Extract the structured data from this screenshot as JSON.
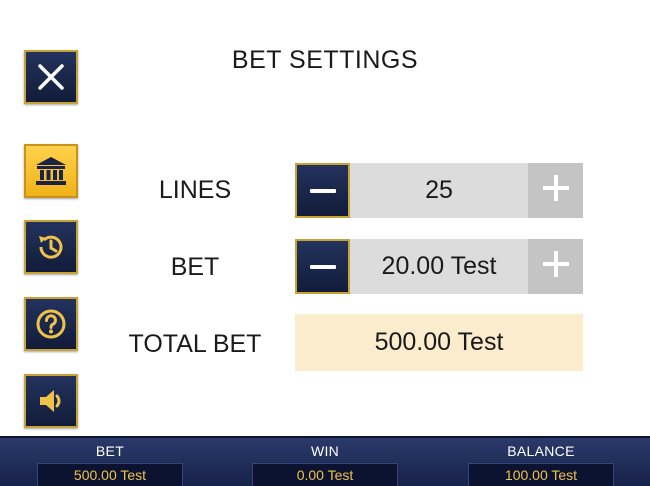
{
  "title": "BET SETTINGS",
  "sidebar": {
    "close": {
      "icon": "close-icon"
    },
    "items": [
      {
        "icon": "bank-icon",
        "active": true
      },
      {
        "icon": "history-icon",
        "active": false
      },
      {
        "icon": "help-icon",
        "active": false
      },
      {
        "icon": "sound-icon",
        "active": false
      }
    ]
  },
  "settings": {
    "lines": {
      "label": "LINES",
      "value": "25"
    },
    "bet": {
      "label": "BET",
      "value": "20.00 Test"
    },
    "total_bet": {
      "label": "TOTAL BET",
      "value": "500.00 Test"
    }
  },
  "bottom_bar": {
    "bet": {
      "label": "BET",
      "value": "500.00 Test"
    },
    "win": {
      "label": "WIN",
      "value": "0.00 Test"
    },
    "balance": {
      "label": "BALANCE",
      "value": "100.00 Test"
    }
  },
  "colors": {
    "button_dark": "#1b2850",
    "button_border_gold": "#c9a234",
    "active_gold": "#f5c12e",
    "control_bg": "#dcdcdc",
    "disabled_btn": "#c4c4c4",
    "total_bg": "#fbeccd",
    "bottom_bar": "#1f2d5a",
    "value_text_gold": "#f0c24a"
  }
}
